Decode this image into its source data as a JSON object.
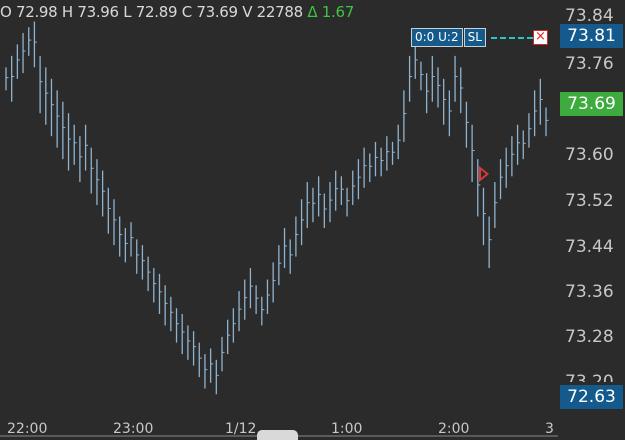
{
  "header": {
    "open": "O 72.98",
    "high": "H 73.96",
    "low": "L 72.89",
    "close": "C 73.69",
    "volume": "V 22788",
    "change": "Δ 1.67"
  },
  "y_axis": {
    "labels": [
      "73.84",
      "73.76",
      "73.60",
      "73.52",
      "73.44",
      "73.36",
      "73.28",
      "73.20"
    ],
    "ask_badge": "73.81",
    "last_badge": "73.69",
    "bid_badge": "72.63"
  },
  "x_axis": {
    "labels": [
      "22:00",
      "23:00",
      "1/12",
      "1:00",
      "2:00",
      "3"
    ]
  },
  "order": {
    "qty_label": "0:0 U:2",
    "type_label": "SL",
    "close_glyph": "×",
    "line_color": "#21c6c6"
  },
  "colors": {
    "background": "#2b2b2b",
    "bars": "#8fb3cf",
    "ask_badge": "#145a8c",
    "last_badge": "#3dab3d",
    "marker": "#d93a3a"
  },
  "chart_data": {
    "type": "ohlc",
    "ylim": [
      73.18,
      73.86
    ],
    "x_ticks": [
      "22:00",
      "23:00",
      "1/12",
      "1:00",
      "2:00",
      "3"
    ],
    "bars": [
      [
        73.76,
        73.72
      ],
      [
        73.78,
        73.7
      ],
      [
        73.8,
        73.74
      ],
      [
        73.82,
        73.75
      ],
      [
        73.83,
        73.78
      ],
      [
        73.84,
        73.76
      ],
      [
        73.78,
        73.68
      ],
      [
        73.76,
        73.66
      ],
      [
        73.74,
        73.64
      ],
      [
        73.72,
        73.62
      ],
      [
        73.7,
        73.6
      ],
      [
        73.68,
        73.58
      ],
      [
        73.66,
        73.59
      ],
      [
        73.64,
        73.56
      ],
      [
        73.66,
        73.58
      ],
      [
        73.62,
        73.54
      ],
      [
        73.6,
        73.52
      ],
      [
        73.58,
        73.5
      ],
      [
        73.55,
        73.47
      ],
      [
        73.53,
        73.45
      ],
      [
        73.5,
        73.43
      ],
      [
        73.48,
        73.42
      ],
      [
        73.49,
        73.43
      ],
      [
        73.46,
        73.4
      ],
      [
        73.45,
        73.39
      ],
      [
        73.43,
        73.37
      ],
      [
        73.41,
        73.35
      ],
      [
        73.4,
        73.33
      ],
      [
        73.38,
        73.31
      ],
      [
        73.36,
        73.3
      ],
      [
        73.34,
        73.28
      ],
      [
        73.33,
        73.26
      ],
      [
        73.31,
        73.25
      ],
      [
        73.3,
        73.24
      ],
      [
        73.28,
        73.22
      ],
      [
        73.26,
        73.2
      ],
      [
        73.27,
        73.21
      ],
      [
        73.25,
        73.19
      ],
      [
        73.29,
        73.23
      ],
      [
        73.32,
        73.26
      ],
      [
        73.34,
        73.28
      ],
      [
        73.37,
        73.3
      ],
      [
        73.39,
        73.32
      ],
      [
        73.41,
        73.34
      ],
      [
        73.38,
        73.33
      ],
      [
        73.36,
        73.31
      ],
      [
        73.39,
        73.33
      ],
      [
        73.42,
        73.35
      ],
      [
        73.45,
        73.38
      ],
      [
        73.48,
        73.41
      ],
      [
        73.46,
        73.4
      ],
      [
        73.5,
        73.43
      ],
      [
        73.53,
        73.45
      ],
      [
        73.56,
        73.48
      ],
      [
        73.55,
        73.49
      ],
      [
        73.57,
        73.5
      ],
      [
        73.54,
        73.48
      ],
      [
        73.56,
        73.49
      ],
      [
        73.58,
        73.51
      ],
      [
        73.57,
        73.52
      ],
      [
        73.55,
        73.5
      ],
      [
        73.58,
        73.52
      ],
      [
        73.6,
        73.53
      ],
      [
        73.62,
        73.55
      ],
      [
        73.61,
        73.56
      ],
      [
        73.63,
        73.57
      ],
      [
        73.62,
        73.57
      ],
      [
        73.64,
        73.58
      ],
      [
        73.63,
        73.59
      ],
      [
        73.66,
        73.6
      ],
      [
        73.72,
        73.63
      ],
      [
        73.78,
        73.7
      ],
      [
        73.8,
        73.74
      ],
      [
        73.77,
        73.72
      ],
      [
        73.75,
        73.68
      ],
      [
        73.78,
        73.7
      ],
      [
        73.76,
        73.69
      ],
      [
        73.74,
        73.66
      ],
      [
        73.72,
        73.64
      ],
      [
        73.78,
        73.7
      ],
      [
        73.76,
        73.68
      ],
      [
        73.7,
        73.62
      ],
      [
        73.66,
        73.56
      ],
      [
        73.6,
        73.5
      ],
      [
        73.55,
        73.45
      ],
      [
        73.5,
        73.41
      ],
      [
        73.56,
        73.48
      ],
      [
        73.6,
        73.53
      ],
      [
        73.62,
        73.55
      ],
      [
        73.64,
        73.57
      ],
      [
        73.66,
        73.59
      ],
      [
        73.65,
        73.6
      ],
      [
        73.68,
        73.62
      ],
      [
        73.72,
        73.64
      ],
      [
        73.74,
        73.66
      ],
      [
        73.69,
        73.64
      ]
    ]
  }
}
